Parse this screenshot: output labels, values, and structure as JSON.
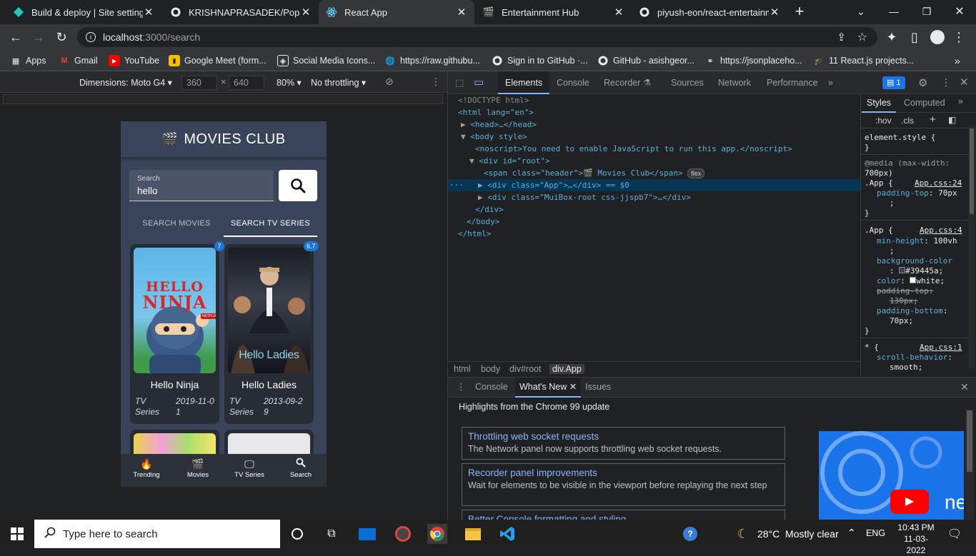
{
  "browser": {
    "tabs": [
      {
        "title": "Build & deploy | Site settings",
        "icon": "netlify-icon"
      },
      {
        "title": "KRISHNAPRASADEK/Popup-c",
        "icon": "github-icon"
      },
      {
        "title": "React App",
        "icon": "react-icon",
        "active": true
      },
      {
        "title": "Entertainment Hub",
        "icon": "film-icon"
      },
      {
        "title": "piyush-eon/react-entertainm",
        "icon": "github-icon"
      }
    ],
    "url_host": "localhost",
    "url_path": ":3000/search",
    "bookmarks": [
      "Apps",
      "Gmail",
      "YouTube",
      "Google Meet (form...",
      "Social Media Icons...",
      "https://raw.githubu...",
      "Sign in to GitHub ·...",
      "GitHub - asishgeor...",
      "https://jsonplaceho...",
      "11 React.js projects..."
    ]
  },
  "device_toolbar": {
    "dimensions_label": "Dimensions: Moto G4",
    "width": "360",
    "height": "640",
    "times": "×",
    "zoom": "80%",
    "throttling": "No throttling"
  },
  "app": {
    "title": "MOVIES CLUB",
    "search_label": "Search",
    "search_value": "hello",
    "tabs": [
      "SEARCH MOVIES",
      "SEARCH TV SERIES"
    ],
    "active_tab": 1,
    "cards": [
      {
        "title": "Hello Ninja",
        "type": "TV Series",
        "date": "2019-11-01",
        "rating": "7",
        "poster_text_1": "HELLO",
        "poster_text_2": "NINJA",
        "poster_badge": "NETFLIX"
      },
      {
        "title": "Hello Ladies",
        "type": "TV Series",
        "date": "2013-09-29",
        "rating": "6.7",
        "poster_text_1": "Hello Ladies"
      }
    ],
    "bottom_nav": [
      "Trending",
      "Movies",
      "TV Series",
      "Search"
    ]
  },
  "devtools": {
    "tabs": [
      "Elements",
      "Console",
      "Recorder",
      "Sources",
      "Network",
      "Performance"
    ],
    "issues_count": "1",
    "dom_lines": [
      {
        "text": "<!DOCTYPE html>"
      },
      {
        "text": "<html lang=\"en\">"
      },
      {
        "text": "<head>…</head>"
      },
      {
        "text": "<body style>"
      },
      {
        "text": "<noscript>You need to enable JavaScript to run this app.</noscript>"
      },
      {
        "text": "<div id=\"root\">"
      },
      {
        "text": "<span class=\"header\">🎬 Movies Club</span>"
      },
      {
        "text": "<div class=\"App\">…</div> == $0"
      },
      {
        "text": "<div class=\"MuiBox-root css-jjspb7\">…</div>"
      },
      {
        "text": "</div>"
      },
      {
        "text": "</body>"
      },
      {
        "text": "</html>"
      }
    ],
    "flex_pill": "flex",
    "crumbs": [
      "html",
      "body",
      "div#root",
      "div.App"
    ],
    "styles_tabs": [
      "Styles",
      "Computed"
    ],
    "filter_hov": ":hov",
    "filter_cls": ".cls",
    "styles": {
      "element_style": "element.style {",
      "close": "}",
      "media": "@media (max-width:",
      "media2": "700px)",
      "sel_app": ".App {",
      "src1": "App.css:24",
      "p1_name": "padding-top",
      "p1_val": "70px",
      "src2": "App.css:4",
      "p2_name": "min-height",
      "p2_val": "100vh",
      "p3_name": "background-color",
      "p3_val": "#39445a;",
      "p4_name": "color",
      "p4_val": "white;",
      "p5_name": "padding-top",
      "p5_val": "130px;",
      "p6_name": "padding-bottom",
      "p6_val": "70px;",
      "sel_star": "* {",
      "src3": "App.css:1",
      "p7_name": "scroll-behavior",
      "p7_val": "smooth;"
    },
    "drawer": {
      "tabs": [
        "Console",
        "What's New",
        "Issues"
      ],
      "heading": "Highlights from the Chrome 99 update",
      "items": [
        {
          "title": "Throttling web socket requests",
          "desc": "The Network panel now supports throttling web socket requests."
        },
        {
          "title": "Recorder panel improvements",
          "desc": "Wait for elements to be visible in the viewport before replaying the next step"
        },
        {
          "title": "Better Console formatting and styling",
          "desc": ""
        }
      ],
      "video_text": "ne"
    }
  },
  "taskbar": {
    "search_placeholder": "Type here to search",
    "weather": "28°C  Mostly clear",
    "lang": "ENG",
    "time": "10:43 PM",
    "date": "11-03-2022"
  },
  "colors": {
    "app_bg": "#39445a",
    "card_bg": "#282c34",
    "badge": "#1976d2",
    "devtools_accent": "#8ab4f8"
  }
}
